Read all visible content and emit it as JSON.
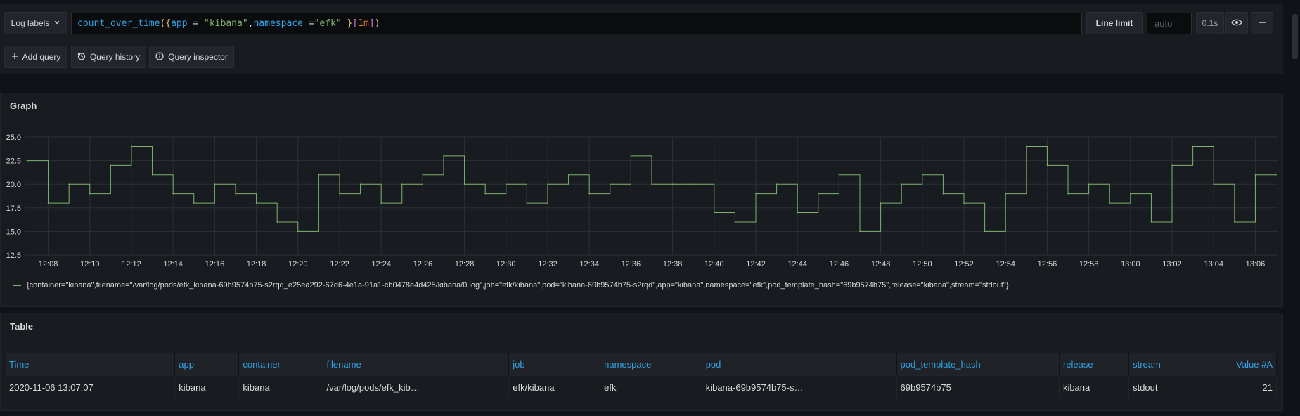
{
  "query_row": {
    "log_labels_button": "Log labels",
    "query_tokens": [
      {
        "text": "count_over_time",
        "cls": "t-fn"
      },
      {
        "text": "(",
        "cls": "t-br1"
      },
      {
        "text": "{",
        "cls": "t-br1"
      },
      {
        "text": "app",
        "cls": "t-lbl"
      },
      {
        "text": " = ",
        "cls": "t-op"
      },
      {
        "text": "\"kibana\"",
        "cls": "t-str"
      },
      {
        "text": ",",
        "cls": "t-op"
      },
      {
        "text": "namespace",
        "cls": "t-lbl"
      },
      {
        "text": " =",
        "cls": "t-op"
      },
      {
        "text": "\"efk\"",
        "cls": "t-str"
      },
      {
        "text": " }",
        "cls": "t-br1"
      },
      {
        "text": "[",
        "cls": "t-br2"
      },
      {
        "text": "1m",
        "cls": "t-num"
      },
      {
        "text": "]",
        "cls": "t-br2"
      },
      {
        "text": ")",
        "cls": "t-br1"
      }
    ],
    "line_limit_label": "Line limit",
    "line_limit_placeholder": "auto",
    "query_time": "0.1s"
  },
  "actions": {
    "add_query": "Add query",
    "query_history": "Query history",
    "query_inspector": "Query inspector"
  },
  "graph": {
    "title": "Graph",
    "legend": "{container=\"kibana\",filename=\"/var/log/pods/efk_kibana-69b9574b75-s2rqd_e25ea292-67d6-4e1a-91a1-cb0478e4d425/kibana/0.log\",job=\"efk/kibana\",pod=\"kibana-69b9574b75-s2rqd\",app=\"kibana\",namespace=\"efk\",pod_template_hash=\"69b9574b75\",release=\"kibana\",stream=\"stdout\"}",
    "line_color": "#7eb26d"
  },
  "chart_data": {
    "type": "line",
    "ylim": [
      12.5,
      25.0
    ],
    "y_ticks": [
      "25.0",
      "22.5",
      "20.0",
      "17.5",
      "15.0",
      "12.5"
    ],
    "x_ticks": [
      "12:08",
      "12:10",
      "12:12",
      "12:14",
      "12:16",
      "12:18",
      "12:20",
      "12:22",
      "12:24",
      "12:26",
      "12:28",
      "12:30",
      "12:32",
      "12:34",
      "12:36",
      "12:38",
      "12:40",
      "12:42",
      "12:44",
      "12:46",
      "12:48",
      "12:50",
      "12:52",
      "12:54",
      "12:56",
      "12:58",
      "13:00",
      "13:02",
      "13:04",
      "13:06"
    ],
    "grid": true,
    "series": [
      {
        "color": "#7eb26d",
        "x": [
          "12:07",
          "12:08",
          "12:09",
          "12:10",
          "12:11",
          "12:12",
          "12:13",
          "12:14",
          "12:15",
          "12:16",
          "12:17",
          "12:18",
          "12:19",
          "12:20",
          "12:21",
          "12:22",
          "12:23",
          "12:24",
          "12:25",
          "12:26",
          "12:27",
          "12:28",
          "12:29",
          "12:30",
          "12:31",
          "12:32",
          "12:33",
          "12:34",
          "12:35",
          "12:36",
          "12:37",
          "12:38",
          "12:39",
          "12:40",
          "12:41",
          "12:42",
          "12:43",
          "12:44",
          "12:45",
          "12:46",
          "12:47",
          "12:48",
          "12:49",
          "12:50",
          "12:51",
          "12:52",
          "12:53",
          "12:54",
          "12:55",
          "12:56",
          "12:57",
          "12:58",
          "12:59",
          "13:00",
          "13:01",
          "13:02",
          "13:03",
          "13:04",
          "13:05",
          "13:06",
          "13:07"
        ],
        "values": [
          22.5,
          18,
          20,
          19,
          22,
          24,
          21,
          19,
          18,
          20,
          19,
          18,
          16,
          15,
          21,
          19,
          20,
          18,
          20,
          21,
          23,
          20,
          19,
          20,
          18,
          20,
          21,
          19,
          20,
          23,
          20,
          20,
          20,
          17,
          16,
          19,
          20,
          17,
          19,
          21,
          15,
          18,
          20,
          21,
          19,
          18,
          15,
          19,
          24,
          22,
          19,
          20,
          18,
          19,
          16,
          22,
          24,
          20,
          16,
          21,
          21
        ]
      }
    ]
  },
  "table": {
    "title": "Table",
    "headers": [
      "Time",
      "app",
      "container",
      "filename",
      "job",
      "namespace",
      "pod",
      "pod_template_hash",
      "release",
      "stream",
      "Value #A"
    ],
    "row": [
      "2020-11-06 13:07:07",
      "kibana",
      "kibana",
      "/var/log/pods/efk_kib…",
      "efk/kibana",
      "efk",
      "kibana-69b9574b75-s…",
      "69b9574b75",
      "kibana",
      "stdout",
      "21"
    ]
  }
}
